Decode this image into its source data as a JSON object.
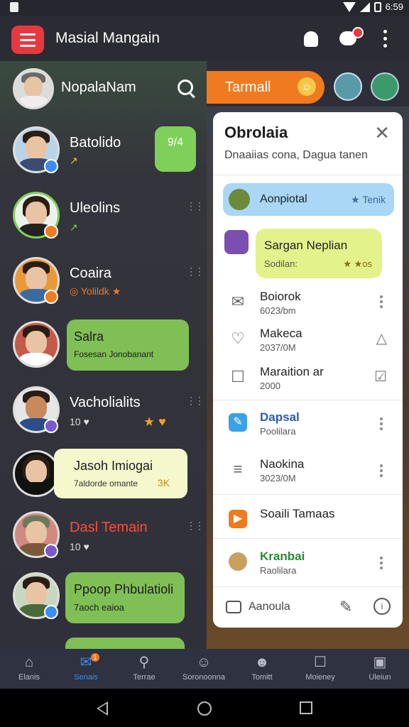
{
  "status": {
    "time": "6:59"
  },
  "appbar": {
    "title": "Masial Mangain"
  },
  "drawer": {
    "profile_name": "NopalaNam",
    "rows": [
      {
        "name": "Batolido",
        "sub": "↗",
        "bubble": "9/4",
        "bubble_color": "#7fd05a"
      },
      {
        "name": "Uleolins",
        "sub": "↗"
      },
      {
        "name": "Coaira",
        "sub": "◎ Yolildk ★"
      },
      {
        "name": "Salra",
        "sub": "Fosesan Jonobanant"
      },
      {
        "name": "Vacholialits",
        "sub": "10 ♥"
      },
      {
        "name": "Jasoh Imiogai",
        "sub": "7aldorde omante"
      },
      {
        "name": "Dasl Temain",
        "sub": "10 ♥"
      },
      {
        "name": "Ppoop Phbulatioli",
        "sub": "7aoch eaioa"
      }
    ],
    "row6_tag": "3K",
    "row5_icons": "★ ♥"
  },
  "right": {
    "pill_label": "Tarmall"
  },
  "card": {
    "title": "Obrolaia",
    "subtitle": "Dnaaiias cona, Dagua tanen",
    "highlight": {
      "label": "Aonpiotal",
      "tag": "★ Tenik"
    },
    "green": {
      "title": "Sargan Neplian",
      "sub": "Sodilan:",
      "tag": "★ ★os"
    },
    "items": [
      {
        "title": "Boiorok",
        "sub": "6023/bm"
      },
      {
        "title": "Makeca",
        "sub": "2037/0M"
      },
      {
        "title": "Maraition ar",
        "sub": "2000"
      },
      {
        "title": "Dapsal",
        "sub": "Poolilara"
      },
      {
        "title": "Naokina",
        "sub": "3023/0M"
      },
      {
        "title": "Soaili Tamaas",
        "sub": ""
      },
      {
        "title": "Kranbai",
        "sub": "Raolilara"
      }
    ],
    "footer_label": "Aanoula"
  },
  "bottomnav": [
    {
      "label": "Elanis",
      "icon": "home-icon"
    },
    {
      "label": "Senais",
      "icon": "mail-icon",
      "badge": "1"
    },
    {
      "label": "Terrae",
      "icon": "search-icon"
    },
    {
      "label": "Soronoonna",
      "icon": "smile-icon"
    },
    {
      "label": "Tomitt",
      "icon": "face-icon"
    },
    {
      "label": "Moieney",
      "icon": "square-icon"
    },
    {
      "label": "Uleiun",
      "icon": "bag-icon"
    }
  ],
  "colors": {
    "accent": "#e8383f",
    "orange": "#f07a1f",
    "active_nav": "#3d8cf0",
    "green_bubble": "#7fd05a"
  }
}
